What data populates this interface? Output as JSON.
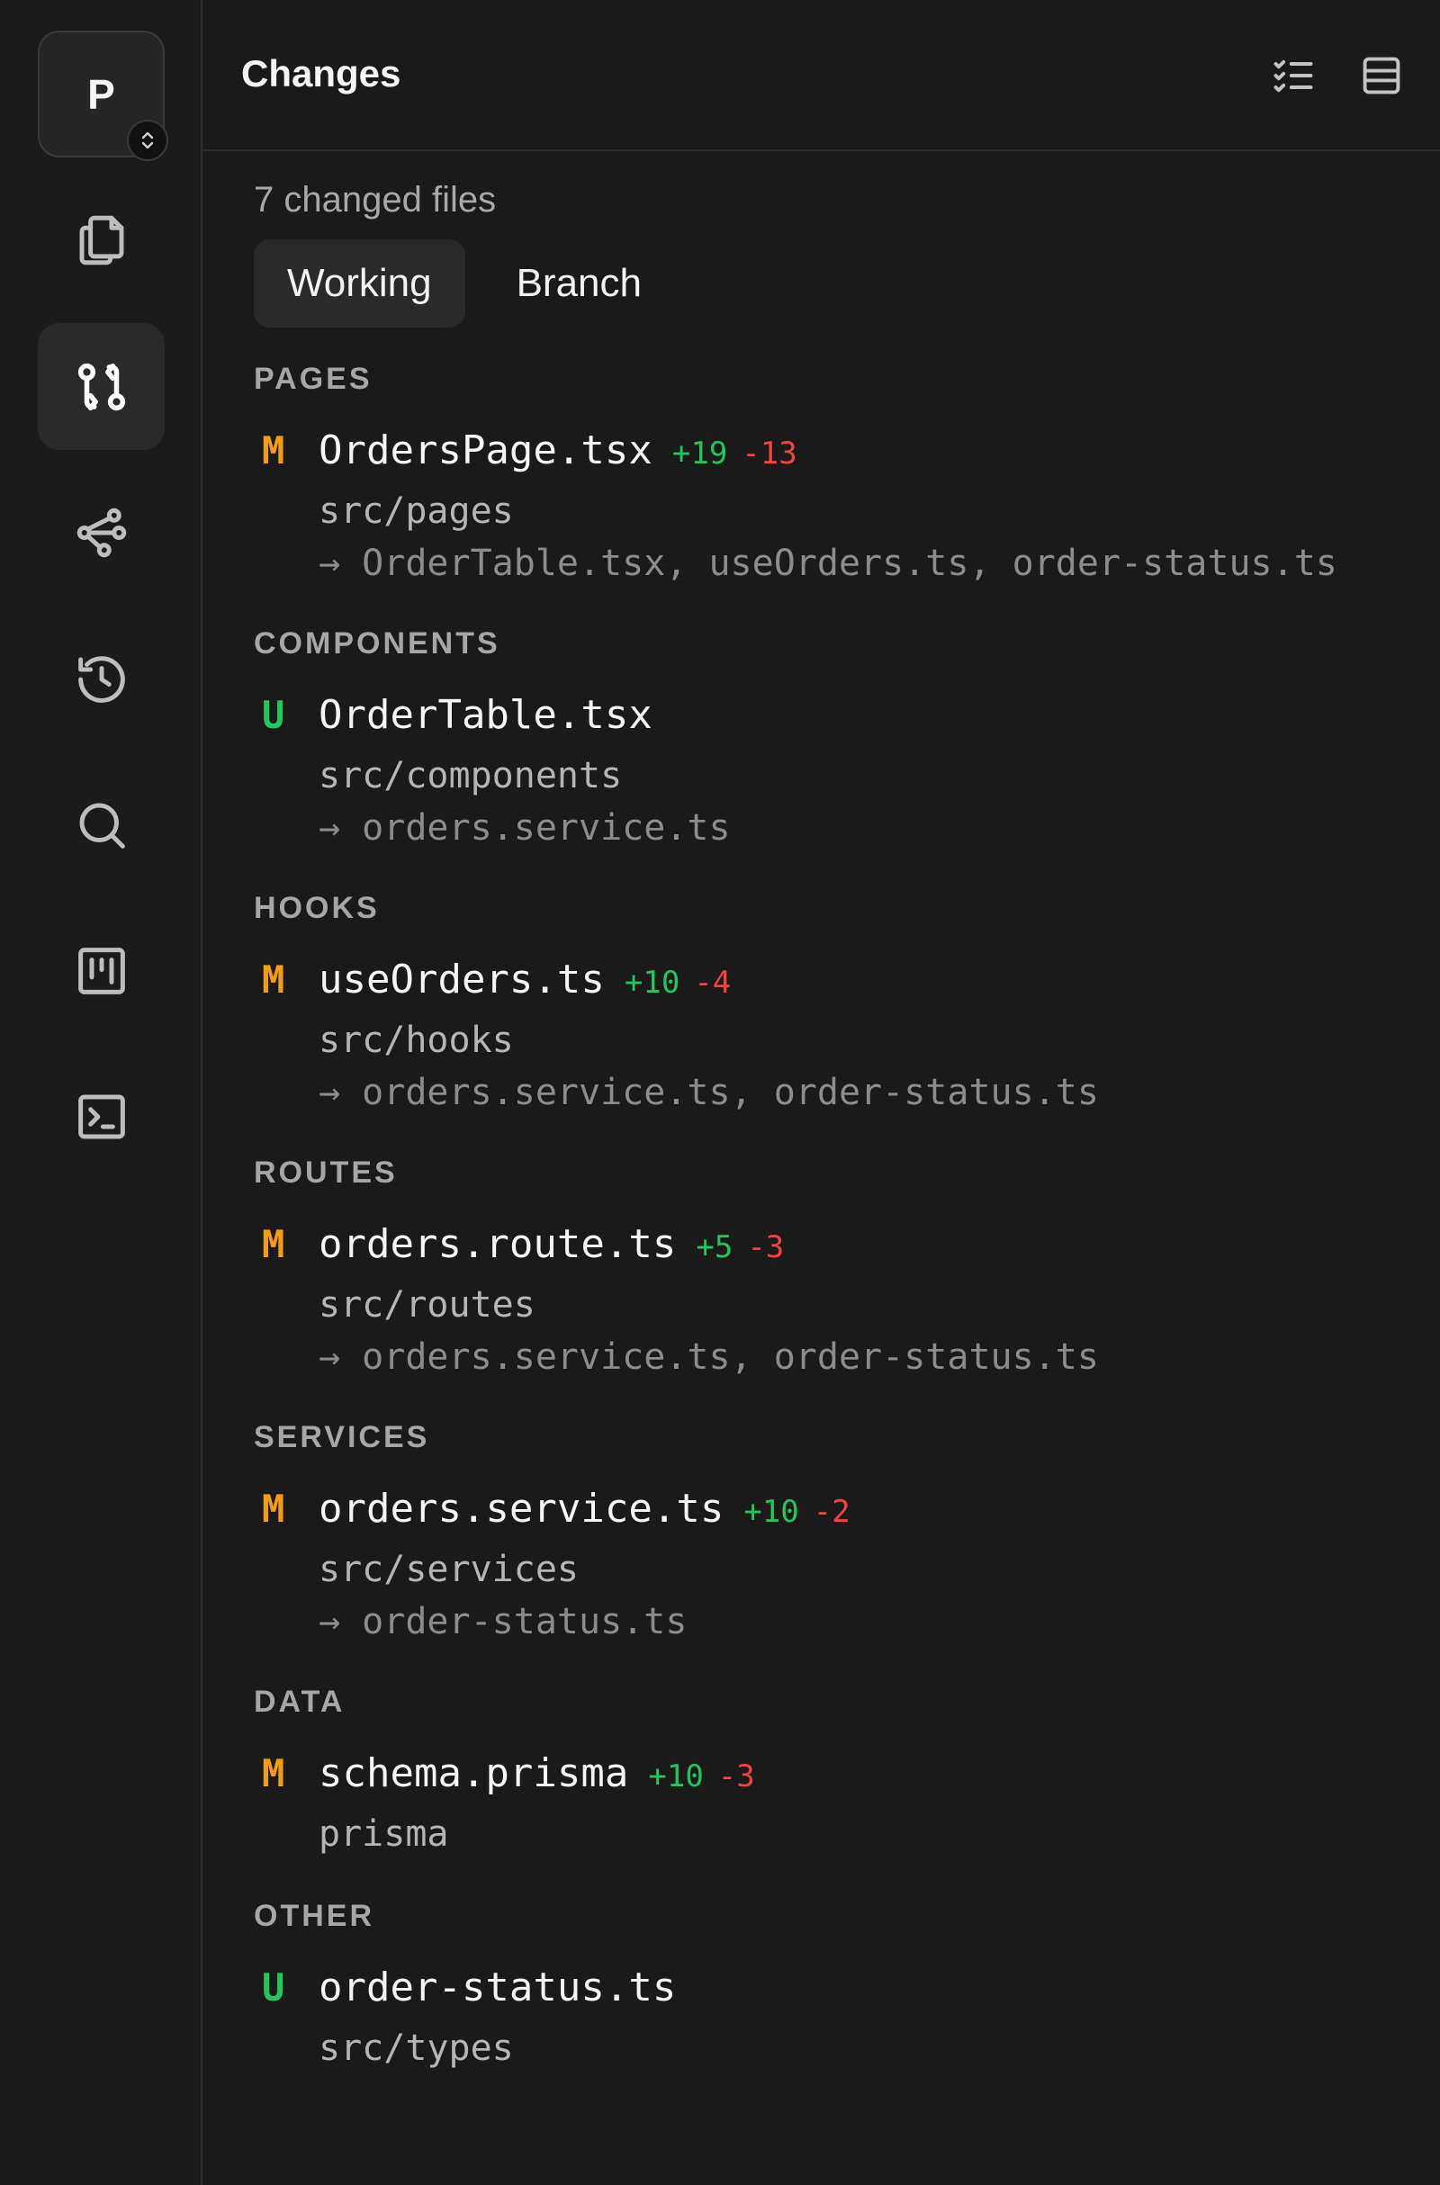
{
  "project": {
    "initial": "P"
  },
  "header": {
    "title": "Changes"
  },
  "summary": {
    "count_label": "7 changed files"
  },
  "tabs": [
    {
      "label": "Working",
      "active": true
    },
    {
      "label": "Branch",
      "active": false
    }
  ],
  "sections": [
    {
      "label": "PAGES",
      "files": [
        {
          "status": "M",
          "name": "OrdersPage.tsx",
          "add": "+19",
          "del": "-13",
          "path": "src/pages",
          "deps": "→ OrderTable.tsx, useOrders.ts, order-status.ts"
        }
      ]
    },
    {
      "label": "COMPONENTS",
      "files": [
        {
          "status": "U",
          "name": "OrderTable.tsx",
          "add": "",
          "del": "",
          "path": "src/components",
          "deps": "→ orders.service.ts"
        }
      ]
    },
    {
      "label": "HOOKS",
      "files": [
        {
          "status": "M",
          "name": "useOrders.ts",
          "add": "+10",
          "del": "-4",
          "path": "src/hooks",
          "deps": "→ orders.service.ts, order-status.ts"
        }
      ]
    },
    {
      "label": "ROUTES",
      "files": [
        {
          "status": "M",
          "name": "orders.route.ts",
          "add": "+5",
          "del": "-3",
          "path": "src/routes",
          "deps": "→ orders.service.ts, order-status.ts"
        }
      ]
    },
    {
      "label": "SERVICES",
      "files": [
        {
          "status": "M",
          "name": "orders.service.ts",
          "add": "+10",
          "del": "-2",
          "path": "src/services",
          "deps": "→ order-status.ts"
        }
      ]
    },
    {
      "label": "DATA",
      "files": [
        {
          "status": "M",
          "name": "schema.prisma",
          "add": "+10",
          "del": "-3",
          "path": "prisma",
          "deps": ""
        }
      ]
    },
    {
      "label": "OTHER",
      "files": [
        {
          "status": "U",
          "name": "order-status.ts",
          "add": "",
          "del": "",
          "path": "src/types",
          "deps": ""
        }
      ]
    }
  ],
  "colors": {
    "modified": "#f59e0b",
    "untracked": "#22c55e",
    "additions": "#22c55e",
    "deletions": "#f04444",
    "background": "#1a1a1a"
  },
  "icons": {
    "rail": [
      "files-icon",
      "git-compare-icon",
      "git-graph-icon",
      "history-icon",
      "search-icon",
      "kanban-icon",
      "terminal-icon"
    ],
    "header": [
      "checklist-icon",
      "rows-icon"
    ],
    "project": "chevron-up-down-icon"
  }
}
